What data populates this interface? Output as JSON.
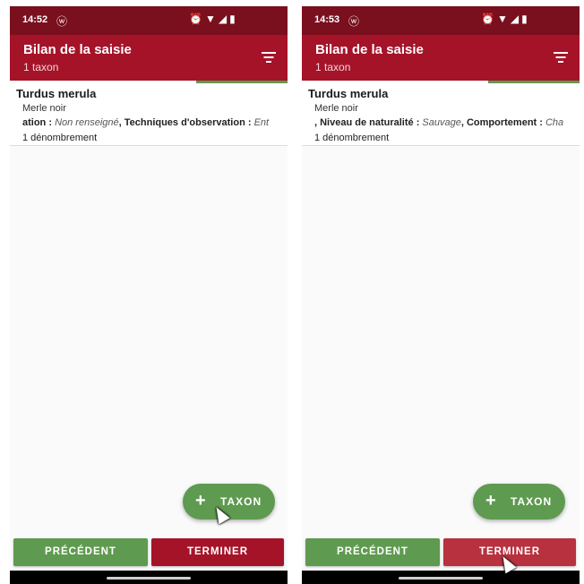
{
  "screens": [
    {
      "status": {
        "time": "14:52"
      },
      "header": {
        "title": "Bilan de la saisie",
        "subtitle": "1 taxon"
      },
      "progress": {
        "fraction": 0.33
      },
      "record": {
        "scientific_name": "Turdus merula",
        "common_name": "Merle noir",
        "details_label_1": "ation : ",
        "details_value_1": "Non renseigné",
        "details_label_2": ", Techniques d'observation : ",
        "details_value_2": "Ent",
        "count": "1 dénombrement"
      },
      "fab": {
        "plus": "+",
        "label": "TAXON"
      },
      "buttons": {
        "previous": "PRÉCÉDENT",
        "finish": "TERMINER"
      }
    },
    {
      "status": {
        "time": "14:53"
      },
      "header": {
        "title": "Bilan de la saisie",
        "subtitle": "1 taxon"
      },
      "progress": {
        "fraction": 0.33
      },
      "record": {
        "scientific_name": "Turdus merula",
        "common_name": "Merle noir",
        "details_label_1": ", Niveau de naturalité : ",
        "details_value_1": "Sauvage",
        "details_label_2": ", Comportement : ",
        "details_value_2": "Cha",
        "count": "1 dénombrement"
      },
      "fab": {
        "plus": "+",
        "label": "TAXON"
      },
      "buttons": {
        "previous": "PRÉCÉDENT",
        "finish": "TERMINER"
      }
    }
  ],
  "colors": {
    "statusbar": "#7a0f1e",
    "appbar": "#a51329",
    "accent_green": "#5e9a4f",
    "finish_button": "#a51329",
    "finish_button_pressed": "#b7313f"
  },
  "icons": {
    "messaging": "whatsapp-icon",
    "alarm": "alarm-icon",
    "wifi": "wifi-icon",
    "signal": "signal-icon",
    "battery": "battery-icon",
    "filter": "filter-icon",
    "add": "plus-icon"
  }
}
